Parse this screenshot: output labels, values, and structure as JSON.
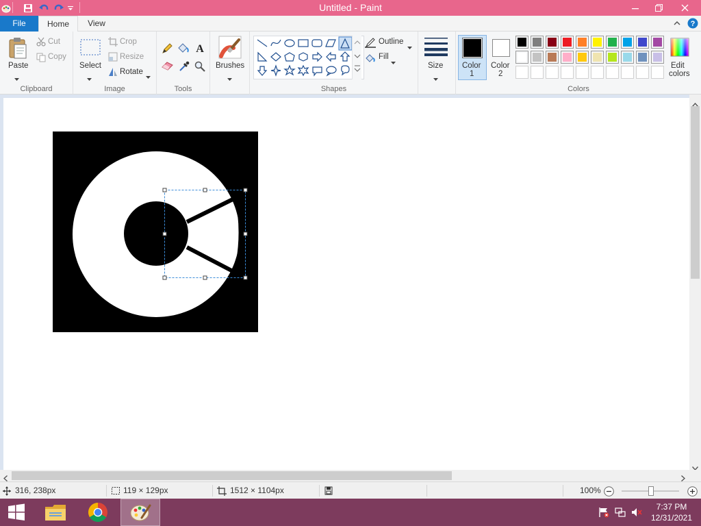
{
  "window": {
    "title": "Untitled - Paint"
  },
  "tabs": {
    "file": "File",
    "home": "Home",
    "view": "View"
  },
  "clipboard": {
    "paste": "Paste",
    "cut": "Cut",
    "copy": "Copy",
    "group": "Clipboard"
  },
  "image": {
    "select": "Select",
    "crop": "Crop",
    "resize": "Resize",
    "rotate": "Rotate",
    "group": "Image"
  },
  "tools": {
    "group": "Tools"
  },
  "brushes": {
    "label": "Brushes"
  },
  "shapes": {
    "outline": "Outline",
    "fill": "Fill",
    "group": "Shapes"
  },
  "size": {
    "label": "Size"
  },
  "colors": {
    "color1_label": "Color",
    "color1_num": "1",
    "color2_label": "Color",
    "color2_num": "2",
    "edit_label": "Edit",
    "edit_label2": "colors",
    "group": "Colors",
    "color1_value": "#000000",
    "color2_value": "#ffffff",
    "palette_row1": [
      "#000000",
      "#7f7f7f",
      "#880015",
      "#ed1c24",
      "#ff7f27",
      "#fff200",
      "#22b14c",
      "#00a2e8",
      "#3f48cc",
      "#a349a4"
    ],
    "palette_row2": [
      "#ffffff",
      "#c3c3c3",
      "#b97a57",
      "#ffaec9",
      "#ffc90e",
      "#efe4b0",
      "#b5e61d",
      "#99d9ea",
      "#7092be",
      "#c8bfe7"
    ],
    "palette_row3": [
      "#ffffff",
      "#ffffff",
      "#ffffff",
      "#ffffff",
      "#ffffff",
      "#ffffff",
      "#ffffff",
      "#ffffff",
      "#ffffff",
      "#ffffff"
    ]
  },
  "status": {
    "cursor_pos": "316, 238px",
    "selection_size": "119 × 129px",
    "image_size": "1512 × 1104px",
    "zoom": "100%"
  },
  "taskbar": {
    "time": "7:37 PM",
    "date": "12/31/2021"
  },
  "theme": {
    "titlebar": "#e8668c",
    "accent": "#1979ca",
    "taskbar": "#7d3b5d"
  }
}
